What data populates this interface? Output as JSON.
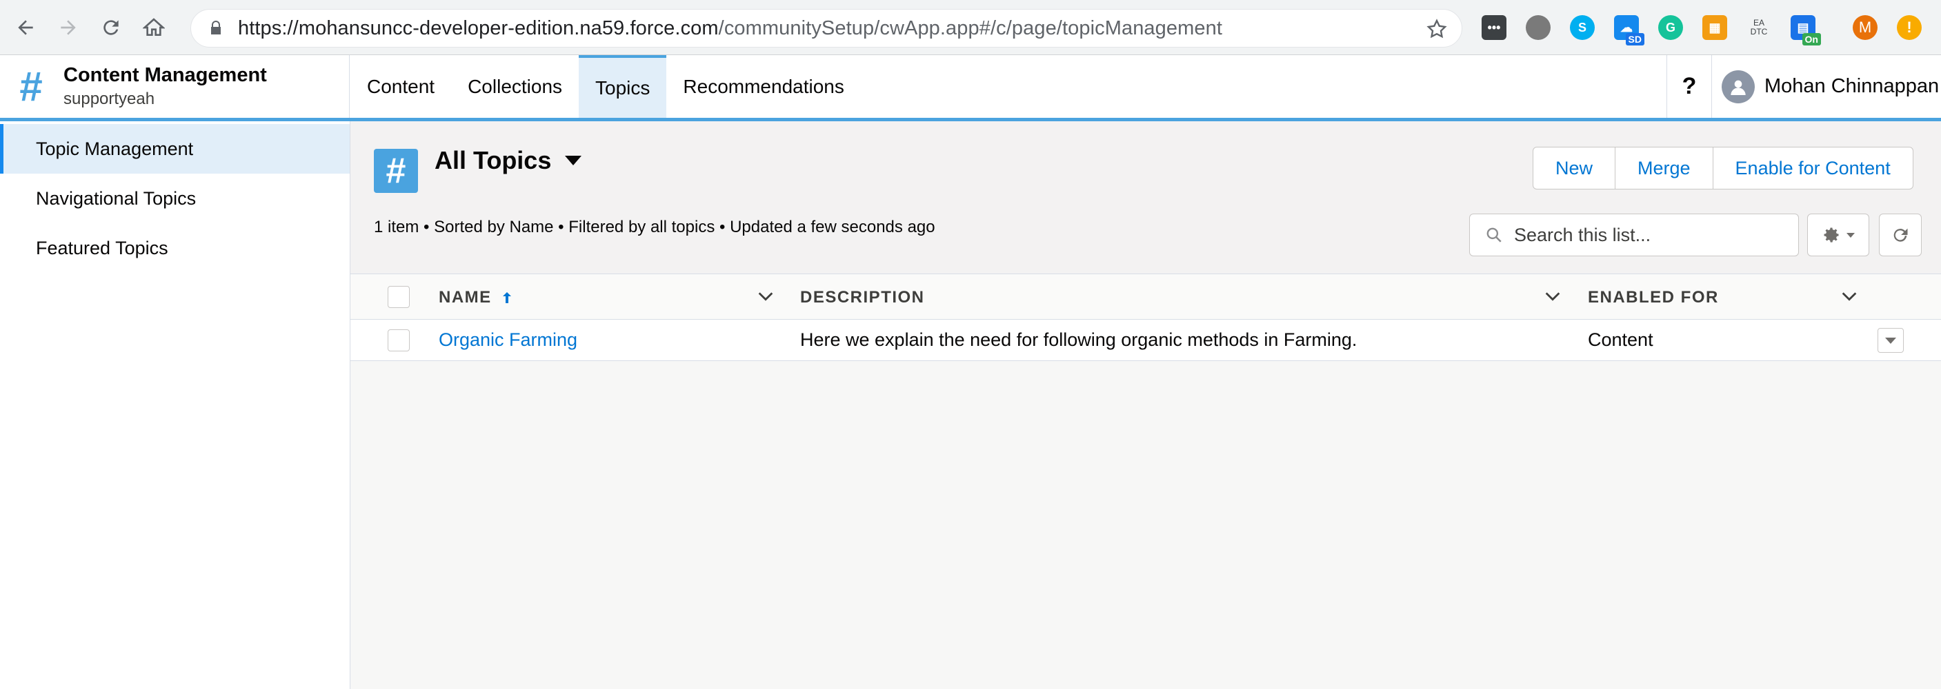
{
  "browser": {
    "url_host": "https://mohansuncc-developer-edition.na59.force.com",
    "url_path": "/communitySetup/cwApp.app#/c/page/topicManagement",
    "extensions": [
      {
        "icon": "more-icon",
        "color": "#3c4043",
        "badge": ""
      },
      {
        "icon": "circle-icon",
        "color": "#7a7a7a",
        "badge": ""
      },
      {
        "icon": "skype-icon",
        "color": "#00aff0",
        "badge": ""
      },
      {
        "icon": "cloud-icon",
        "color": "#1589ee",
        "badge": "SD"
      },
      {
        "icon": "grammarly-icon",
        "color": "#15c39a",
        "badge": ""
      },
      {
        "icon": "grid-icon",
        "color": "#f39c12",
        "badge": ""
      },
      {
        "icon": "eadtc-icon",
        "color": "#ffffff",
        "badge": ""
      },
      {
        "icon": "calendar-icon",
        "color": "#1a73e8",
        "badge": "On"
      },
      {
        "icon": "profile-icon",
        "color": "#e8710a",
        "badge": ""
      },
      {
        "icon": "alert-icon",
        "color": "#f9ab00",
        "badge": ""
      }
    ],
    "profile_initial": "M",
    "eadtc_label": "EA DTC"
  },
  "app": {
    "title": "Content Management",
    "subtitle": "supportyeah",
    "tabs": [
      {
        "label": "Content",
        "active": false
      },
      {
        "label": "Collections",
        "active": false
      },
      {
        "label": "Topics",
        "active": true
      },
      {
        "label": "Recommendations",
        "active": false
      }
    ],
    "help_label": "?",
    "user_name": "Mohan Chinnappan"
  },
  "sidebar": {
    "items": [
      {
        "label": "Topic Management",
        "active": true
      },
      {
        "label": "Navigational Topics",
        "active": false
      },
      {
        "label": "Featured Topics",
        "active": false
      }
    ]
  },
  "list": {
    "title": "All Topics",
    "meta": "1 item • Sorted by Name • Filtered by all topics • Updated a few seconds ago",
    "buttons": {
      "new": "New",
      "merge": "Merge",
      "enable": "Enable for Content"
    },
    "search_placeholder": "Search this list...",
    "columns": {
      "name": "NAME",
      "description": "DESCRIPTION",
      "enabled_for": "ENABLED FOR"
    },
    "rows": [
      {
        "name": "Organic Farming",
        "description": "Here we explain the need for following organic methods in Farming.",
        "enabled_for": "Content"
      }
    ]
  },
  "colors": {
    "accent": "#4aa3df",
    "link": "#0176d3",
    "active_bg": "#e1eef9"
  }
}
